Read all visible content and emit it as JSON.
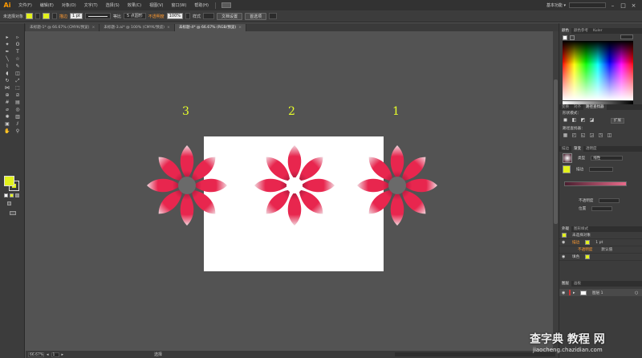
{
  "app": {
    "logo": "Ai"
  },
  "menu": [
    "文件(F)",
    "编辑(E)",
    "对象(O)",
    "文字(T)",
    "选择(S)",
    "效果(C)",
    "视图(V)",
    "窗口(W)",
    "帮助(H)"
  ],
  "workspace": {
    "label": "基本功能 ▾",
    "search_placeholder": ""
  },
  "control": {
    "selection_label": "未选择对象",
    "stroke_label": "描边",
    "stroke_value": "1 pt",
    "stroke_profile": "等比",
    "brush": "5 点圆形",
    "opacity_label": "不透明度",
    "opacity_value": "100%",
    "style_label": "样式",
    "doc_setup": "文档设置",
    "preferences": "首选项"
  },
  "tabs": [
    {
      "label": "未标题-1* @ 66.67% (CMYK/预览)",
      "active": false
    },
    {
      "label": "未标题-3.ai* @ 100% (CMYK/预览)",
      "active": false
    },
    {
      "label": "未标题-4* @ 66.67% (RGB/预览)",
      "active": true
    }
  ],
  "canvas": {
    "labels": [
      "3",
      "2",
      "1"
    ],
    "colors": {
      "petal_outer": "#f2f0f2",
      "petal_mid": "#e8264e",
      "petal_inner": "#7a1030",
      "accent": "#e3f21c"
    }
  },
  "status": {
    "zoom": "66.67%",
    "page": "1",
    "tool": "选择"
  },
  "panels": {
    "color_tabs": [
      "颜色",
      "颜色参考",
      "Kuler"
    ],
    "pathfinder_tabs": [
      "变换",
      "对齐",
      "路径查找器"
    ],
    "shape_modes": "形状模式：",
    "expand": "扩展",
    "pathfinders": "路径查找器：",
    "gradient_tabs": [
      "描边",
      "渐变",
      "透明度"
    ],
    "gradient_type_label": "类型",
    "gradient_type": "线性",
    "gradient_stroke_label": "描边",
    "opacity_label": "不透明度",
    "position_label": "位置",
    "appearance_tabs": [
      "外观",
      "图形样式"
    ],
    "appearance_object": "未选择对象",
    "appearance_stroke": "描边",
    "appearance_stroke_value": "1 pt",
    "appearance_opacity_link": "不透明度",
    "appearance_opacity_value": "默认值",
    "appearance_fill": "填色",
    "layers_tabs": [
      "图层",
      "画板"
    ],
    "layer_name": "图层 1"
  },
  "watermark": {
    "text": "查字典 教程 网",
    "url": "jiaocheng.chazidian.com"
  }
}
